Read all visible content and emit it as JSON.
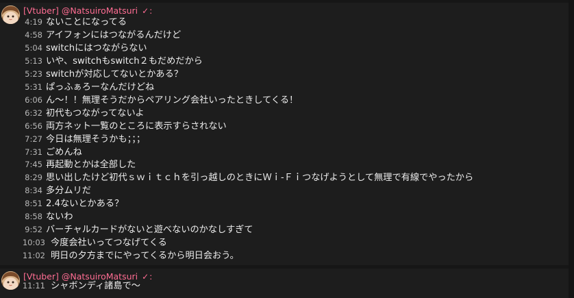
{
  "group1": {
    "badge": "[Vtuber]",
    "author": "@NatsuiroMatsuri",
    "verified": "✓",
    "colon": ":",
    "messages": [
      {
        "time": "4:19",
        "text": "ないことになってる"
      },
      {
        "time": "4:58",
        "text": "アイフォンにはつながるんだけど"
      },
      {
        "time": "5:04",
        "text": "switchにはつながらない"
      },
      {
        "time": "5:13",
        "text": "いや、switchもswitch２もだめだから"
      },
      {
        "time": "5:23",
        "text": "switchが対応してないとかある？"
      },
      {
        "time": "5:31",
        "text": "ぱっふぁろーなんだけどね"
      },
      {
        "time": "6:06",
        "text": "ん～！！無理そうだからペアリング会社いったときしてくる！"
      },
      {
        "time": "6:32",
        "text": "初代もつながってないよ"
      },
      {
        "time": "6:56",
        "text": "両方ネット一覧のところに表示すらされない"
      },
      {
        "time": "7:27",
        "text": "今日は無理そうかも；；；"
      },
      {
        "time": "7:31",
        "text": "ごめんね"
      },
      {
        "time": "7:45",
        "text": "再起動とかは全部した"
      },
      {
        "time": "8:29",
        "text": "思い出したけど初代ｓｗｉｔｃｈを引っ越しのときにＷｉ-Ｆｉつなげようとして無理で有線でやったから"
      },
      {
        "time": "8:34",
        "text": "多分ムリだ"
      },
      {
        "time": "8:51",
        "text": "2.4ないとかある？"
      },
      {
        "time": "8:58",
        "text": "ないわ"
      },
      {
        "time": "9:52",
        "text": "バーチャルカードがないと遊べないのかなしすぎて"
      },
      {
        "time": "10:03",
        "text": "今度会社いってつなげてくる"
      },
      {
        "time": "11:02",
        "text": "明日の夕方までにやってくるから明日会おう。"
      }
    ]
  },
  "group2": {
    "badge": "[Vtuber]",
    "author": "@NatsuiroMatsuri",
    "verified": "✓",
    "colon": ":",
    "messages": [
      {
        "time": "11:11",
        "text": "シャボンディ諸島で～"
      }
    ]
  },
  "colors": {
    "background": "#161616",
    "group_background": "#1d1d1d",
    "author": "#ff6d93",
    "timestamp": "#b7b7b7",
    "text": "#ececec"
  },
  "icons": {
    "avatar": "avatar-icon",
    "verified": "verified-check-icon"
  }
}
